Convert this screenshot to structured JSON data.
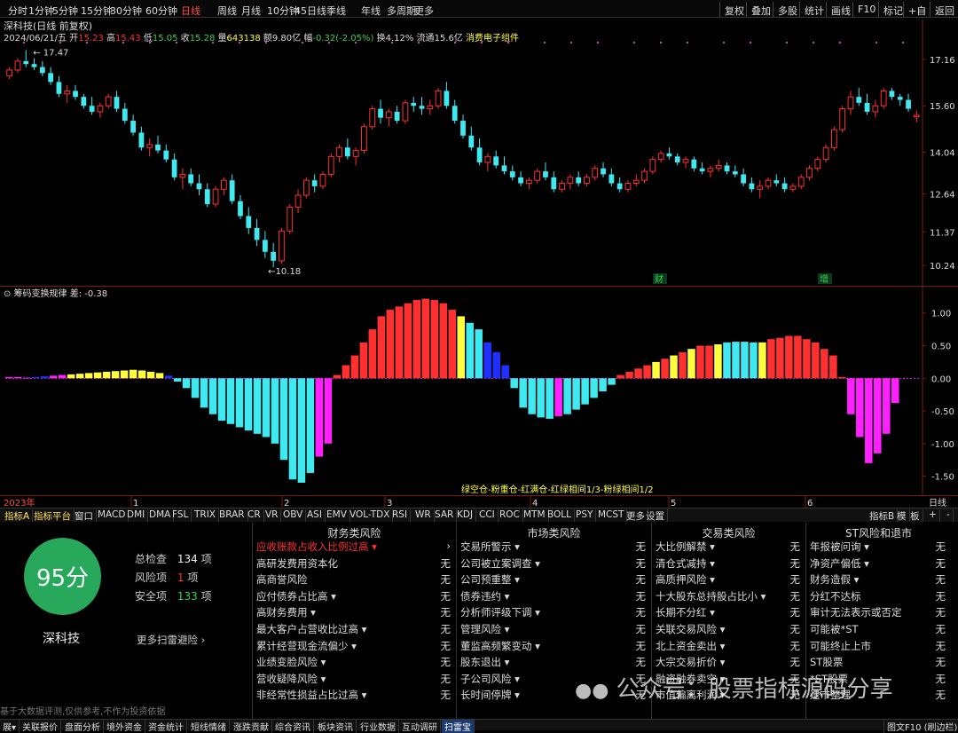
{
  "toolbar": {
    "periods": [
      "分时",
      "1分钟",
      "5分钟",
      "15分钟",
      "30分钟",
      "60分钟",
      "日线",
      "周线",
      "月线",
      "10分钟",
      "45日线",
      "季线",
      "年线",
      "多周期",
      "更多"
    ],
    "active": "日线",
    "right_buttons": [
      "复权",
      "叠加",
      "多股",
      "统计",
      "画线",
      "F10",
      "标记",
      "+自",
      "返回"
    ]
  },
  "quote": {
    "title": "深科技(日线 前复权)",
    "date": "2024/06/21/五",
    "open_label": "开",
    "open": "15.23",
    "high_label": "高",
    "high": "15.43",
    "low_label": "低",
    "low": "15.05",
    "close_label": "收",
    "close": "15.28",
    "vol_label": "量",
    "volume": "643138",
    "amount_label": "额",
    "amount": "9.80亿",
    "change_label": "幅",
    "change": "-0.32(-2.05%)",
    "turnover_label": "换",
    "turnover": "4.12%",
    "float_label": "流通",
    "float": "15.6亿",
    "sector": "消费电子组件"
  },
  "price_axis": [
    "17.16",
    "15.60",
    "14.04",
    "12.64",
    "11.37",
    "10.24"
  ],
  "price_marks": {
    "high": "17.47",
    "low": "10.18"
  },
  "tags": [
    "财",
    "增"
  ],
  "indicator": {
    "name": "筹码变换规律",
    "value_label": "差:",
    "value": "-0.38"
  },
  "ind_axis": [
    "1.00",
    "0.50",
    "0.00",
    "-0.50",
    "-1.00",
    "-1.50"
  ],
  "legend": "绿空仓-粉重仓-红满仓-红绿相间1/3-粉绿相间1/2",
  "time_axis": {
    "year": "2023年",
    "months": [
      "1",
      "2",
      "3",
      "4",
      "5",
      "6"
    ],
    "period": "日线"
  },
  "colors": {
    "up": "#ff3030",
    "down": "#40e8f0",
    "magenta": "#ff20ff",
    "yellow": "#ffff40",
    "blue": "#2030ff",
    "score": "#27a85b"
  },
  "indicator_tabs": [
    "指标A",
    "指标平台",
    "窗口",
    "MACD",
    "DMI",
    "DMA",
    "FSL",
    "TRIX",
    "BRAR",
    "CR",
    "VR",
    "OBV",
    "ASI",
    "EMV",
    "VOL-TDX",
    "RSI",
    "WR",
    "SAR",
    "KDJ",
    "CCI",
    "ROC",
    "MTM",
    "BOLL",
    "PSY",
    "MCST",
    "更多",
    "设置"
  ],
  "indicator_tabs_right": [
    "指标B",
    "模",
    "板",
    "+",
    "-"
  ],
  "scan": {
    "score": "95分",
    "stock": "深科技",
    "total_label": "总检查",
    "total": "134",
    "total_unit": "项",
    "risk_label": "风险项",
    "risk": "1",
    "risk_unit": "项",
    "safe_label": "安全项",
    "safe": "133",
    "safe_unit": "项",
    "more": "更多扫雷避险 ›",
    "disclaimer": "基于大数据评测,仅供参考,不作为投资依据"
  },
  "panels": [
    {
      "title": "财务类风险",
      "rows": [
        {
          "label": "应收账款占收入比例过高 ▾",
          "value": "›",
          "highlight": true
        },
        {
          "label": "高研发费用资本化",
          "value": "无"
        },
        {
          "label": "高商誉风险",
          "value": "无"
        },
        {
          "label": "应付债券占比高 ▾",
          "value": "无"
        },
        {
          "label": "高财务费用 ▾",
          "value": "无"
        },
        {
          "label": "最大客户占营收比过高 ▾",
          "value": "无"
        },
        {
          "label": "累计经营现金流偏少 ▾",
          "value": "无"
        },
        {
          "label": "业绩变脸风险 ▾",
          "value": "无"
        },
        {
          "label": "营收疑降风险 ▾",
          "value": "无"
        },
        {
          "label": "非经常性损益占比过高 ▾",
          "value": "无"
        }
      ]
    },
    {
      "title": "市场类风险",
      "rows": [
        {
          "label": "交易所警示 ▾",
          "value": "无"
        },
        {
          "label": "公司被立案调查 ▾",
          "value": "无"
        },
        {
          "label": "公司预重整 ▾",
          "value": "无"
        },
        {
          "label": "债券违约 ▾",
          "value": "无"
        },
        {
          "label": "分析师评级下调 ▾",
          "value": "无"
        },
        {
          "label": "管理风险 ▾",
          "value": "无"
        },
        {
          "label": "董监高频繁变动 ▾",
          "value": "无"
        },
        {
          "label": "股东退出 ▾",
          "value": "无"
        },
        {
          "label": "子公司风险 ▾",
          "value": "无"
        },
        {
          "label": "长时间停牌 ▾",
          "value": "无"
        }
      ]
    },
    {
      "title": "交易类风险",
      "rows": [
        {
          "label": "大比例解禁 ▾",
          "value": "无"
        },
        {
          "label": "清仓式减持 ▾",
          "value": "无"
        },
        {
          "label": "高质押风险 ▾",
          "value": "无"
        },
        {
          "label": "十大股东总持股占比小 ▾",
          "value": "无"
        },
        {
          "label": "长期不分红 ▾",
          "value": "无"
        },
        {
          "label": "关联交易风险 ▾",
          "value": "无"
        },
        {
          "label": "北上资金卖出 ▾",
          "value": "无"
        },
        {
          "label": "大宗交易折价 ▾",
          "value": "无"
        },
        {
          "label": "融资融券卖空 ▾",
          "value": "无"
        },
        {
          "label": "市值偏离利润 ▾",
          "value": "无"
        }
      ]
    },
    {
      "title": "ST风险和退市",
      "rows": [
        {
          "label": "年报被问询 ▾",
          "value": "无"
        },
        {
          "label": "净资产偏低 ▾",
          "value": "无"
        },
        {
          "label": "财务造假 ▾",
          "value": "无"
        },
        {
          "label": "分红不达标",
          "value": "无"
        },
        {
          "label": "审计无法表示或否定",
          "value": "无"
        },
        {
          "label": "可能被*ST",
          "value": "无"
        },
        {
          "label": "可能终止上市",
          "value": "无"
        },
        {
          "label": "ST股票",
          "value": "无"
        },
        {
          "label": "*ST股票",
          "value": "无"
        },
        {
          "label": "退市整理",
          "value": "无"
        }
      ]
    }
  ],
  "watermark": "公众号：股票指标源码分享",
  "bottom_tabs": [
    "展▾",
    "关联报价",
    "盘面分析",
    "境外资金",
    "资金统计",
    "短线情绪",
    "涨跌贡献",
    "综合资讯",
    "板块资讯",
    "行业数据",
    "互动调研",
    "扫雷宝"
  ],
  "bottom_right": "图文F10 (刷边栏)»",
  "chart_data": {
    "type": "candlestick",
    "candles": [
      [
        16.6,
        16.9,
        16.5,
        16.8
      ],
      [
        16.8,
        17.2,
        16.7,
        17.1
      ],
      [
        17.1,
        17.47,
        16.9,
        17.0
      ],
      [
        17.0,
        17.2,
        16.8,
        16.9
      ],
      [
        16.9,
        17.1,
        16.6,
        16.7
      ],
      [
        16.7,
        16.9,
        16.3,
        16.4
      ],
      [
        16.4,
        16.6,
        15.9,
        16.0
      ],
      [
        16.0,
        16.3,
        15.7,
        16.1
      ],
      [
        16.1,
        16.3,
        15.8,
        15.9
      ],
      [
        15.9,
        16.0,
        15.5,
        15.6
      ],
      [
        15.6,
        15.9,
        15.3,
        15.4
      ],
      [
        15.4,
        15.7,
        15.2,
        15.6
      ],
      [
        15.6,
        16.0,
        15.5,
        15.9
      ],
      [
        15.9,
        16.1,
        15.4,
        15.5
      ],
      [
        15.5,
        15.7,
        15.0,
        15.1
      ],
      [
        15.1,
        15.3,
        14.6,
        14.7
      ],
      [
        14.7,
        14.9,
        14.1,
        14.2
      ],
      [
        14.2,
        14.5,
        13.9,
        14.3
      ],
      [
        14.3,
        14.6,
        14.0,
        14.1
      ],
      [
        14.1,
        14.3,
        13.7,
        13.8
      ],
      [
        13.8,
        14.0,
        13.1,
        13.2
      ],
      [
        13.2,
        13.5,
        12.8,
        13.3
      ],
      [
        13.3,
        13.5,
        12.9,
        13.0
      ],
      [
        13.0,
        13.3,
        12.6,
        12.8
      ],
      [
        12.8,
        13.0,
        12.2,
        12.3
      ],
      [
        12.3,
        12.9,
        12.2,
        12.8
      ],
      [
        12.8,
        13.2,
        12.6,
        13.1
      ],
      [
        13.1,
        13.3,
        12.3,
        12.4
      ],
      [
        12.4,
        12.6,
        11.8,
        11.9
      ],
      [
        11.9,
        12.2,
        11.3,
        11.5
      ],
      [
        11.5,
        11.8,
        10.9,
        11.1
      ],
      [
        11.1,
        11.4,
        10.5,
        10.7
      ],
      [
        10.7,
        11.0,
        10.18,
        10.4
      ],
      [
        10.4,
        11.5,
        10.3,
        11.4
      ],
      [
        11.4,
        12.3,
        11.3,
        12.2
      ],
      [
        12.2,
        12.8,
        12.0,
        12.6
      ],
      [
        12.6,
        13.2,
        12.5,
        13.1
      ],
      [
        13.1,
        13.3,
        12.7,
        12.9
      ],
      [
        12.9,
        13.4,
        12.8,
        13.3
      ],
      [
        13.3,
        14.0,
        13.2,
        13.9
      ],
      [
        13.9,
        14.3,
        13.7,
        14.2
      ],
      [
        14.2,
        14.5,
        13.8,
        13.9
      ],
      [
        13.9,
        14.2,
        13.6,
        14.1
      ],
      [
        14.1,
        15.0,
        14.0,
        14.9
      ],
      [
        14.9,
        15.6,
        14.8,
        15.5
      ],
      [
        15.5,
        15.8,
        15.0,
        15.2
      ],
      [
        15.2,
        15.5,
        14.9,
        15.4
      ],
      [
        15.4,
        15.6,
        15.0,
        15.1
      ],
      [
        15.1,
        15.8,
        15.0,
        15.7
      ],
      [
        15.7,
        15.9,
        15.4,
        15.6
      ],
      [
        15.6,
        15.9,
        15.3,
        15.5
      ],
      [
        15.5,
        15.8,
        15.3,
        15.6
      ],
      [
        15.6,
        16.2,
        15.5,
        16.1
      ],
      [
        16.1,
        16.4,
        15.5,
        15.6
      ],
      [
        15.6,
        15.8,
        15.0,
        15.1
      ],
      [
        15.1,
        15.3,
        14.5,
        14.6
      ],
      [
        14.6,
        14.9,
        14.1,
        14.2
      ],
      [
        14.2,
        14.5,
        13.6,
        13.7
      ],
      [
        13.7,
        14.0,
        13.4,
        13.9
      ],
      [
        13.9,
        14.1,
        13.5,
        13.6
      ],
      [
        13.6,
        13.9,
        13.3,
        13.4
      ],
      [
        13.4,
        13.6,
        13.1,
        13.2
      ],
      [
        13.2,
        13.4,
        12.9,
        13.0
      ],
      [
        13.0,
        13.2,
        12.8,
        13.1
      ],
      [
        13.1,
        13.5,
        13.0,
        13.4
      ],
      [
        13.4,
        13.7,
        13.1,
        13.2
      ],
      [
        13.2,
        13.4,
        12.7,
        12.8
      ],
      [
        12.8,
        13.1,
        12.7,
        13.0
      ],
      [
        13.0,
        13.3,
        12.8,
        13.2
      ],
      [
        13.2,
        13.4,
        12.9,
        13.0
      ],
      [
        13.0,
        13.3,
        12.9,
        13.2
      ],
      [
        13.2,
        13.6,
        13.1,
        13.5
      ],
      [
        13.5,
        13.7,
        13.2,
        13.3
      ],
      [
        13.3,
        13.5,
        12.9,
        13.0
      ],
      [
        13.0,
        13.2,
        12.7,
        12.8
      ],
      [
        12.8,
        13.1,
        12.7,
        13.0
      ],
      [
        13.0,
        13.3,
        12.9,
        13.1
      ],
      [
        13.1,
        13.5,
        13.0,
        13.4
      ],
      [
        13.4,
        13.9,
        13.3,
        13.8
      ],
      [
        13.8,
        14.1,
        13.7,
        14.0
      ],
      [
        14.0,
        14.2,
        13.8,
        13.9
      ],
      [
        13.9,
        14.0,
        13.6,
        13.7
      ],
      [
        13.7,
        13.9,
        13.5,
        13.8
      ],
      [
        13.8,
        13.9,
        13.4,
        13.5
      ],
      [
        13.5,
        13.7,
        13.3,
        13.4
      ],
      [
        13.4,
        13.6,
        13.2,
        13.5
      ],
      [
        13.5,
        13.8,
        13.4,
        13.6
      ],
      [
        13.6,
        13.7,
        13.3,
        13.4
      ],
      [
        13.4,
        13.6,
        13.2,
        13.3
      ],
      [
        13.3,
        13.5,
        12.9,
        13.0
      ],
      [
        13.0,
        13.2,
        12.7,
        12.8
      ],
      [
        12.8,
        13.1,
        12.5,
        12.9
      ],
      [
        12.9,
        13.2,
        12.8,
        13.1
      ],
      [
        13.1,
        13.3,
        12.9,
        13.0
      ],
      [
        13.0,
        13.2,
        12.7,
        12.8
      ],
      [
        12.8,
        13.0,
        12.7,
        12.9
      ],
      [
        12.9,
        13.3,
        12.8,
        13.2
      ],
      [
        13.2,
        13.6,
        13.1,
        13.5
      ],
      [
        13.5,
        13.9,
        13.4,
        13.8
      ],
      [
        13.8,
        14.3,
        13.7,
        14.2
      ],
      [
        14.2,
        14.9,
        14.1,
        14.8
      ],
      [
        14.8,
        15.6,
        14.7,
        15.5
      ],
      [
        15.5,
        16.1,
        15.3,
        15.9
      ],
      [
        15.9,
        16.2,
        15.6,
        15.7
      ],
      [
        15.7,
        16.0,
        15.3,
        15.4
      ],
      [
        15.4,
        15.8,
        15.2,
        15.6
      ],
      [
        15.6,
        16.2,
        15.5,
        16.1
      ],
      [
        16.1,
        16.2,
        15.8,
        15.9
      ],
      [
        15.9,
        16.0,
        15.6,
        15.8
      ],
      [
        15.8,
        16.0,
        15.4,
        15.5
      ],
      [
        15.23,
        15.43,
        15.05,
        15.28
      ]
    ],
    "indicator": {
      "name": "筹码变换规律",
      "bars": [
        [
          0.02,
          "magenta"
        ],
        [
          0.02,
          "magenta"
        ],
        [
          0.01,
          "magenta"
        ],
        [
          0.02,
          "blue"
        ],
        [
          0.03,
          "blue"
        ],
        [
          0.04,
          "magenta"
        ],
        [
          0.05,
          "magenta"
        ],
        [
          0.06,
          "yellow"
        ],
        [
          0.07,
          "yellow"
        ],
        [
          0.08,
          "yellow"
        ],
        [
          0.09,
          "yellow"
        ],
        [
          0.1,
          "yellow"
        ],
        [
          0.11,
          "yellow"
        ],
        [
          0.12,
          "yellow"
        ],
        [
          0.13,
          "yellow"
        ],
        [
          0.12,
          "yellow"
        ],
        [
          0.1,
          "yellow"
        ],
        [
          0.08,
          "yellow"
        ],
        [
          0.04,
          "blue"
        ],
        [
          -0.05,
          "cyan"
        ],
        [
          -0.15,
          "cyan"
        ],
        [
          -0.3,
          "cyan"
        ],
        [
          -0.45,
          "cyan"
        ],
        [
          -0.55,
          "cyan"
        ],
        [
          -0.65,
          "cyan"
        ],
        [
          -0.7,
          "cyan"
        ],
        [
          -0.75,
          "cyan"
        ],
        [
          -0.8,
          "cyan"
        ],
        [
          -0.85,
          "cyan"
        ],
        [
          -0.9,
          "cyan"
        ],
        [
          -1.0,
          "cyan"
        ],
        [
          -1.25,
          "cyan"
        ],
        [
          -1.55,
          "cyan"
        ],
        [
          -1.6,
          "cyan"
        ],
        [
          -1.45,
          "cyan"
        ],
        [
          -1.2,
          "magenta"
        ],
        [
          -1.0,
          "magenta"
        ],
        [
          0.05,
          "red"
        ],
        [
          0.2,
          "red"
        ],
        [
          0.35,
          "red"
        ],
        [
          0.55,
          "red"
        ],
        [
          0.75,
          "red"
        ],
        [
          0.95,
          "red"
        ],
        [
          1.05,
          "red"
        ],
        [
          1.1,
          "red"
        ],
        [
          1.15,
          "red"
        ],
        [
          1.2,
          "red"
        ],
        [
          1.22,
          "red"
        ],
        [
          1.2,
          "red"
        ],
        [
          1.15,
          "red"
        ],
        [
          1.05,
          "red"
        ],
        [
          0.95,
          "yellow"
        ],
        [
          0.85,
          "cyan"
        ],
        [
          0.75,
          "cyan"
        ],
        [
          0.55,
          "blue"
        ],
        [
          0.4,
          "blue"
        ],
        [
          0.2,
          "blue"
        ],
        [
          -0.15,
          "cyan"
        ],
        [
          -0.45,
          "cyan"
        ],
        [
          -0.55,
          "cyan"
        ],
        [
          -0.6,
          "cyan"
        ],
        [
          -0.62,
          "cyan"
        ],
        [
          -0.58,
          "magenta"
        ],
        [
          -0.55,
          "cyan"
        ],
        [
          -0.48,
          "cyan"
        ],
        [
          -0.4,
          "cyan"
        ],
        [
          -0.3,
          "cyan"
        ],
        [
          -0.2,
          "cyan"
        ],
        [
          -0.1,
          "cyan"
        ],
        [
          0.05,
          "red"
        ],
        [
          0.1,
          "red"
        ],
        [
          0.15,
          "red"
        ],
        [
          0.2,
          "red"
        ],
        [
          0.25,
          "yellow"
        ],
        [
          0.3,
          "red"
        ],
        [
          0.35,
          "yellow"
        ],
        [
          0.4,
          "red"
        ],
        [
          0.45,
          "yellow"
        ],
        [
          0.5,
          "red"
        ],
        [
          0.5,
          "red"
        ],
        [
          0.52,
          "yellow"
        ],
        [
          0.55,
          "cyan"
        ],
        [
          0.56,
          "cyan"
        ],
        [
          0.56,
          "cyan"
        ],
        [
          0.55,
          "cyan"
        ],
        [
          0.55,
          "yellow"
        ],
        [
          0.6,
          "red"
        ],
        [
          0.62,
          "red"
        ],
        [
          0.65,
          "red"
        ],
        [
          0.65,
          "red"
        ],
        [
          0.6,
          "red"
        ],
        [
          0.55,
          "red"
        ],
        [
          0.45,
          "red"
        ],
        [
          0.35,
          "red"
        ],
        [
          0.02,
          "red"
        ],
        [
          -0.55,
          "magenta"
        ],
        [
          -0.9,
          "magenta"
        ],
        [
          -1.3,
          "magenta"
        ],
        [
          -1.15,
          "magenta"
        ],
        [
          -0.85,
          "magenta"
        ],
        [
          -0.38,
          "magenta"
        ]
      ]
    },
    "ylim": [
      9.8,
      17.9
    ],
    "indicator_ylim": [
      -1.75,
      1.35
    ]
  }
}
